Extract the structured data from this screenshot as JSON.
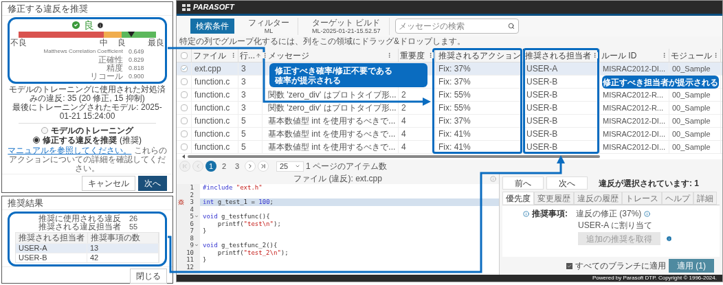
{
  "recommend_dialog": {
    "title": "修正する違反を推奨",
    "rating": "良",
    "gauge": {
      "level": 0.82,
      "labels": [
        "不良",
        "中",
        "良",
        "最良"
      ]
    },
    "metrics": [
      {
        "label": "Matthews Correlation Coefficient",
        "value": "0.649"
      },
      {
        "label": "正確性",
        "value": "0.829"
      },
      {
        "label": "精度",
        "value": "0.818"
      },
      {
        "label": "リコール",
        "value": "0.900"
      }
    ],
    "info_lines": [
      "モデルのトレーニングに使用された対処済みの違反: 35 (20 修正, 15 抑制)",
      "最後にトレーニングされたモデル: 2025-01-21 15:24:00"
    ],
    "options": [
      {
        "label": "モデルのトレーニング",
        "selected": false
      },
      {
        "label": "修正する違反を推奨",
        "note": "(推奨)",
        "selected": true
      }
    ],
    "link": "マニュアルを参照してください。",
    "link_rest": "これらのアクションについての詳細を確認してください。",
    "buttons": [
      {
        "label": "キャンセル",
        "kind": "secondary"
      },
      {
        "label": "次へ",
        "kind": "primary"
      }
    ]
  },
  "results_dialog": {
    "title": "推奨結果",
    "stats": [
      {
        "label": "推奨に使用される違反",
        "value": "26"
      },
      {
        "label": "推奨される違反担当者",
        "value": "55"
      }
    ],
    "columns": [
      "推奨される担当者",
      "推奨事項の数"
    ],
    "rows": [
      {
        "cells": [
          "USER-A",
          "13"
        ],
        "selected": true
      },
      {
        "cells": [
          "USER-B",
          "42"
        ],
        "selected": false
      }
    ],
    "button": "閉じる"
  },
  "app": {
    "logo": "PARASOFT",
    "toolbar": {
      "search_criteria": "検索条件",
      "filter": {
        "label": "フィルター",
        "value": "ML"
      },
      "target_build": {
        "label": "ターゲット ビルド",
        "value": "ML-2025-01-21-15.52.57"
      },
      "search": {
        "placeholder": "メッセージの検索"
      }
    },
    "group_hint": "特定の列でグループ化するには、列をこの領域にドラッグ&ドロップします。",
    "table": {
      "select_all": {
        "checked": false
      },
      "columns": [
        {
          "label": "ファイル",
          "menu": true,
          "sorted": false
        },
        {
          "label": "行...",
          "menu": true,
          "sorted": true
        },
        {
          "label": "メッセージ",
          "menu": true,
          "sorted": false
        },
        {
          "label": "重要度",
          "menu": true,
          "sorted": false
        },
        {
          "label": "推奨されるアクション",
          "menu": false,
          "sorted": false
        },
        {
          "label": "推奨される担当者",
          "menu": true,
          "sorted": false
        },
        {
          "label": "ルール ID",
          "menu": true,
          "sorted": false
        },
        {
          "label": "モジュール",
          "menu": true,
          "sorted": false
        }
      ],
      "rows": [
        {
          "checked": true,
          "selected": true,
          "file": "ext.cpp",
          "line": "3",
          "action": "Fix: 37%",
          "assignee": "USER-A",
          "rule": "MISRAC2012-DI...",
          "module": "00_Sample"
        },
        {
          "checked": false,
          "selected": false,
          "file": "function.c",
          "line": "3",
          "action": "Fix: 37%",
          "assignee": "USER-B"
        },
        {
          "checked": false,
          "selected": false,
          "file": "function.c",
          "line": "3",
          "message": "関数 'zero_div' はプロトタイプ形...",
          "severity": "2",
          "action": "Fix: 55%",
          "assignee": "USER-B",
          "rule": "MISRAC2012-R...",
          "module": "00_Sample"
        },
        {
          "checked": false,
          "selected": false,
          "file": "function.c",
          "line": "3",
          "message": "関数 'zero_div' はプロトタイプ形...",
          "severity": "2",
          "action": "Fix: 55%",
          "assignee": "USER-B",
          "rule": "MISRAC2012-R...",
          "module": "00_Sample"
        },
        {
          "checked": false,
          "selected": false,
          "file": "function.c",
          "line": "5",
          "message": "基本数値型 int を使用するべきで...",
          "severity": "4",
          "action": "Fix: 37%",
          "assignee": "USER-B",
          "rule": "MISRAC2012-DI...",
          "module": "00_Sample"
        },
        {
          "checked": false,
          "selected": false,
          "file": "function.c",
          "line": "5",
          "message": "基本数値型 int を使用するべきで...",
          "severity": "4",
          "action": "Fix: 41%",
          "assignee": "USER-B",
          "rule": "MISRAC2012-DI...",
          "module": "00_Sample"
        },
        {
          "checked": false,
          "selected": false,
          "file": "function.c",
          "line": "5",
          "message": "基本数値型 int を使用するべきで...",
          "severity": "4",
          "action": "Fix: 41%",
          "assignee": "USER-B",
          "rule": "MISRAC2012-DI...",
          "module": "00_Sample"
        }
      ]
    },
    "pagination": {
      "buttons": [
        {
          "kind": "first",
          "disabled": true
        },
        {
          "kind": "prev",
          "disabled": true
        },
        {
          "kind": "page",
          "label": "1",
          "selected": true
        },
        {
          "kind": "page",
          "label": "2",
          "selected": false
        },
        {
          "kind": "page",
          "label": "3",
          "selected": false
        },
        {
          "kind": "next",
          "disabled": false
        },
        {
          "kind": "last",
          "disabled": false
        }
      ],
      "page_size": "25",
      "page_size_label": "1 ページのアイテム数"
    },
    "code_panel": {
      "title": "ファイル (違反): ext.cpp",
      "lines": [
        {
          "no": "1",
          "highlighted": false,
          "violation": false,
          "foldable": false,
          "tokens": [
            {
              "text": "#include ",
              "kind": "keyword"
            },
            {
              "text": "\"ext.h\"",
              "kind": "string"
            }
          ]
        },
        {
          "no": "2",
          "highlighted": false,
          "violation": false,
          "foldable": false
        },
        {
          "no": "3",
          "highlighted": true,
          "violation": true,
          "foldable": false,
          "tokens": [
            {
              "text": "int",
              "kind": "keyword"
            },
            {
              "text": " g_test_1 = ",
              "kind": "plain"
            },
            {
              "text": "100",
              "kind": "number"
            },
            {
              "text": ";",
              "kind": "plain"
            }
          ]
        },
        {
          "no": "4",
          "highlighted": false,
          "violation": false,
          "foldable": false
        },
        {
          "no": "5",
          "highlighted": false,
          "violation": false,
          "foldable": true,
          "tokens": [
            {
              "text": "void",
              "kind": "keyword"
            },
            {
              "text": " g_testfunc(){",
              "kind": "plain"
            }
          ]
        },
        {
          "no": "6",
          "highlighted": false,
          "violation": false,
          "foldable": false,
          "tokens": [
            {
              "text": "    printf(",
              "kind": "plain"
            },
            {
              "text": "\"test\\n\"",
              "kind": "string"
            },
            {
              "text": ");",
              "kind": "plain"
            }
          ]
        },
        {
          "no": "7",
          "highlighted": false,
          "violation": false,
          "foldable": false,
          "tokens": [
            {
              "text": "}",
              "kind": "plain"
            }
          ]
        },
        {
          "no": "8",
          "highlighted": false,
          "violation": false,
          "foldable": false
        },
        {
          "no": "9",
          "highlighted": false,
          "violation": false,
          "foldable": true,
          "tokens": [
            {
              "text": "void",
              "kind": "keyword"
            },
            {
              "text": " g_testfunc_2(){",
              "kind": "plain"
            }
          ]
        },
        {
          "no": "10",
          "highlighted": false,
          "violation": false,
          "foldable": false,
          "tokens": [
            {
              "text": "    printf(",
              "kind": "plain"
            },
            {
              "text": "\"test_2\\n\"",
              "kind": "string"
            },
            {
              "text": ");",
              "kind": "plain"
            }
          ]
        },
        {
          "no": "11",
          "highlighted": false,
          "violation": false,
          "foldable": false,
          "tokens": [
            {
              "text": "}",
              "kind": "plain"
            }
          ]
        },
        {
          "no": "12",
          "highlighted": false,
          "violation": false,
          "foldable": false
        }
      ]
    },
    "detail_panel": {
      "nav_buttons": [
        "前へ",
        "次へ"
      ],
      "selection_text": "違反が選択されています: 1",
      "tabs": [
        {
          "label": "優先度",
          "selected": true
        },
        {
          "label": "変更履歴",
          "selected": false
        },
        {
          "label": "違反の履歴",
          "selected": false
        },
        {
          "label": "トレース",
          "selected": false
        },
        {
          "label": "ヘルプ",
          "selected": false
        },
        {
          "label": "詳細",
          "selected": false
        }
      ],
      "recommendation_label": "推奨事項:",
      "fix": "違反の修正 (37%)",
      "assign": "USER-A に割り当て",
      "more_button": {
        "label": "追加の推奨を取得",
        "disabled": true
      },
      "apply_all": {
        "label": "すべてのブランチに適用",
        "checked": true
      },
      "apply_button": "適用 (1)"
    },
    "footer": "Powered by Parasoft DTP. Copyright © 1996-2024."
  },
  "annotations": [
    {
      "lines": [
        "修正すべき確率/修正不要である",
        "確率が提示される"
      ]
    },
    {
      "lines": [
        "修正すべき担当者が提示される"
      ]
    }
  ]
}
